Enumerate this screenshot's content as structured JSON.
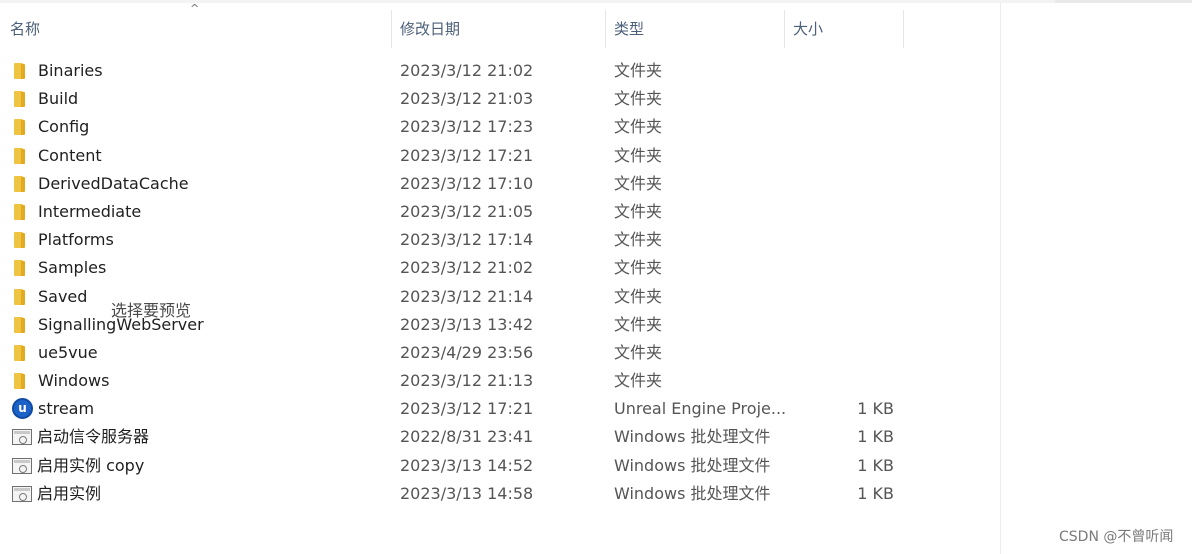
{
  "columns": {
    "name": "名称",
    "date": "修改日期",
    "type": "类型",
    "size": "大小",
    "sort_arrow": "^"
  },
  "files": [
    {
      "name": "Binaries",
      "date": "2023/3/12 21:02",
      "type": "文件夹",
      "size": "",
      "icon": "folder-icon"
    },
    {
      "name": "Build",
      "date": "2023/3/12 21:03",
      "type": "文件夹",
      "size": "",
      "icon": "folder-icon"
    },
    {
      "name": "Config",
      "date": "2023/3/12 17:23",
      "type": "文件夹",
      "size": "",
      "icon": "folder-icon"
    },
    {
      "name": "Content",
      "date": "2023/3/12 17:21",
      "type": "文件夹",
      "size": "",
      "icon": "folder-icon"
    },
    {
      "name": "DerivedDataCache",
      "date": "2023/3/12 17:10",
      "type": "文件夹",
      "size": "",
      "icon": "folder-icon"
    },
    {
      "name": "Intermediate",
      "date": "2023/3/12 21:05",
      "type": "文件夹",
      "size": "",
      "icon": "folder-icon"
    },
    {
      "name": "Platforms",
      "date": "2023/3/12 17:14",
      "type": "文件夹",
      "size": "",
      "icon": "folder-icon"
    },
    {
      "name": "Samples",
      "date": "2023/3/12 21:02",
      "type": "文件夹",
      "size": "",
      "icon": "folder-icon"
    },
    {
      "name": "Saved",
      "date": "2023/3/12 21:14",
      "type": "文件夹",
      "size": "",
      "icon": "folder-icon"
    },
    {
      "name": "SignallingWebServer",
      "date": "2023/3/13 13:42",
      "type": "文件夹",
      "size": "",
      "icon": "folder-icon"
    },
    {
      "name": "ue5vue",
      "date": "2023/4/29 23:56",
      "type": "文件夹",
      "size": "",
      "icon": "folder-icon"
    },
    {
      "name": "Windows",
      "date": "2023/3/12 21:13",
      "type": "文件夹",
      "size": "",
      "icon": "folder-icon"
    },
    {
      "name": "stream",
      "date": "2023/3/12 17:21",
      "type": "Unreal Engine Proje...",
      "size": "1 KB",
      "icon": "unreal-engine-icon"
    },
    {
      "name": "启动信令服务器",
      "date": "2022/8/31 23:41",
      "type": "Windows 批处理文件",
      "size": "1 KB",
      "icon": "batch-file-icon"
    },
    {
      "name": "启用实例 copy",
      "date": "2023/3/13 14:52",
      "type": "Windows 批处理文件",
      "size": "1 KB",
      "icon": "batch-file-icon"
    },
    {
      "name": "启用实例",
      "date": "2023/3/13 14:58",
      "type": "Windows 批处理文件",
      "size": "1 KB",
      "icon": "batch-file-icon"
    }
  ],
  "preview": {
    "message": "选择要预览"
  },
  "watermark": "CSDN @不曾听闻",
  "colors": {
    "folder": "#f0c443",
    "header_text": "#4c607a",
    "unreal_blue": "#1b63c9"
  }
}
